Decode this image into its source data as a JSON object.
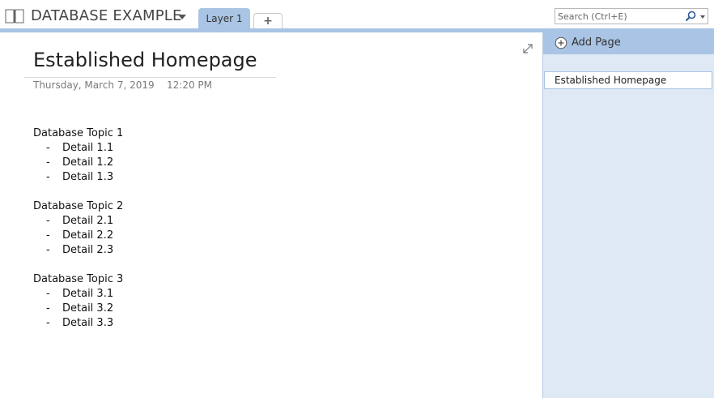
{
  "notebook": {
    "title": "DATABASE EXAMPLE",
    "icon": "notebook-icon"
  },
  "tabs": [
    {
      "label": "Layer 1",
      "active": true
    },
    {
      "label": "+",
      "role": "add-section"
    }
  ],
  "search": {
    "placeholder": "Search (Ctrl+E)",
    "value": ""
  },
  "page": {
    "title": "Established Homepage",
    "date": "Thursday, March 7, 2019",
    "time": "12:20 PM",
    "topics": [
      {
        "title": "Database Topic 1",
        "details": [
          "Detail 1.1",
          "Detail 1.2",
          "Detail 1.3"
        ]
      },
      {
        "title": "Database Topic 2",
        "details": [
          "Detail 2.1",
          "Detail 2.2",
          "Detail 2.3"
        ]
      },
      {
        "title": "Database Topic 3",
        "details": [
          "Detail 3.1",
          "Detail 3.2",
          "Detail 3.3"
        ]
      }
    ],
    "bullet": "-"
  },
  "pane": {
    "add_page_label": "Add Page",
    "pages": [
      "Established Homepage"
    ]
  },
  "colors": {
    "accent": "#a9c4e4",
    "pane_bg": "#dfe9f5"
  }
}
